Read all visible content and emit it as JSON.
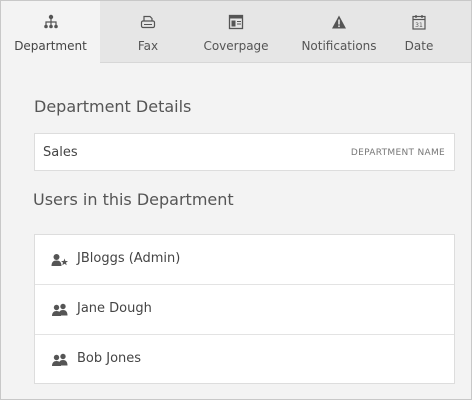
{
  "tabs": [
    {
      "label": "Department",
      "icon": "org-chart-icon",
      "active": true
    },
    {
      "label": "Fax",
      "icon": "fax-icon",
      "active": false
    },
    {
      "label": "Coverpage",
      "icon": "coverpage-icon",
      "active": false
    },
    {
      "label": "Notifications",
      "icon": "warning-icon",
      "active": false
    },
    {
      "label": "Date",
      "icon": "calendar-icon",
      "active": false
    }
  ],
  "calendar_day": "31",
  "department": {
    "title": "Department Details",
    "name_value": "Sales",
    "name_hint": "DEPARTMENT NAME"
  },
  "users": {
    "title": "Users in this Department",
    "items": [
      {
        "name": "JBloggs (Admin)",
        "icon": "admin-user-icon"
      },
      {
        "name": "Jane Dough",
        "icon": "users-icon"
      },
      {
        "name": "Bob Jones",
        "icon": "users-icon"
      }
    ]
  },
  "colors": {
    "tabbar_bg": "#e6e6e6",
    "panel_bg": "#f3f3f3",
    "icon": "#555555"
  }
}
